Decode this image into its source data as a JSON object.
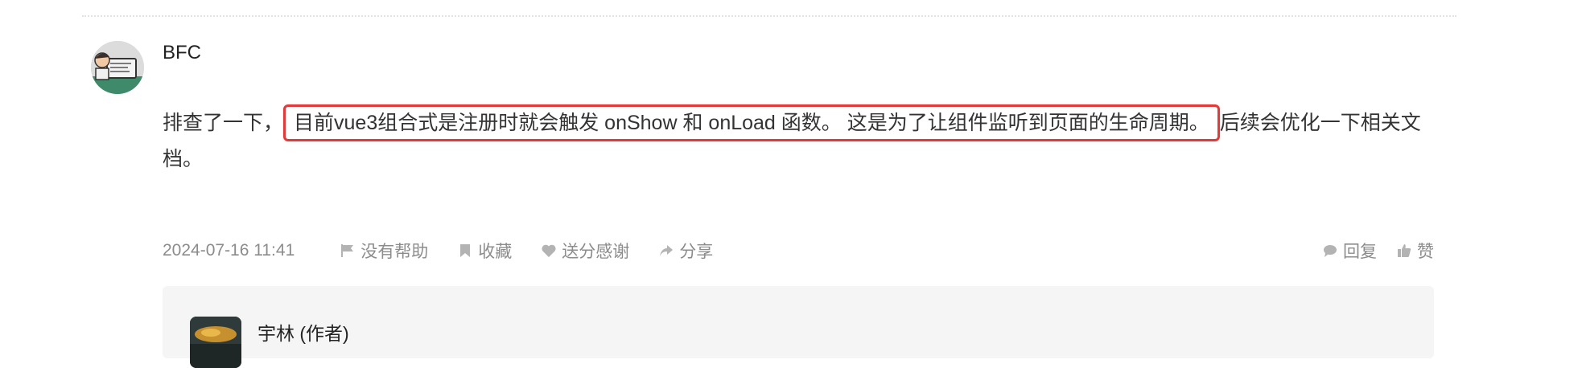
{
  "comment": {
    "author": "BFC",
    "text_before": "排查了一下，",
    "text_highlight": "目前vue3组合式是注册时就会触发 onShow 和 onLoad 函数。 这是为了让组件监听到页面的生命周期。",
    "text_after": "后续会优化一下相关文档。",
    "highlight_color": "#e03a3a",
    "date": "2024-07-16 11:41",
    "actions": [
      {
        "label": "没有帮助",
        "icon": "flag-icon"
      },
      {
        "label": "收藏",
        "icon": "bookmark-icon"
      },
      {
        "label": "送分感谢",
        "icon": "heart-icon"
      },
      {
        "label": "分享",
        "icon": "share-icon"
      }
    ],
    "right_actions": [
      {
        "label": "回复",
        "icon": "speech-bubble-icon"
      },
      {
        "label": "赞",
        "icon": "thumbs-up-icon"
      }
    ]
  },
  "reply": {
    "author": "宇林 (作者)"
  }
}
